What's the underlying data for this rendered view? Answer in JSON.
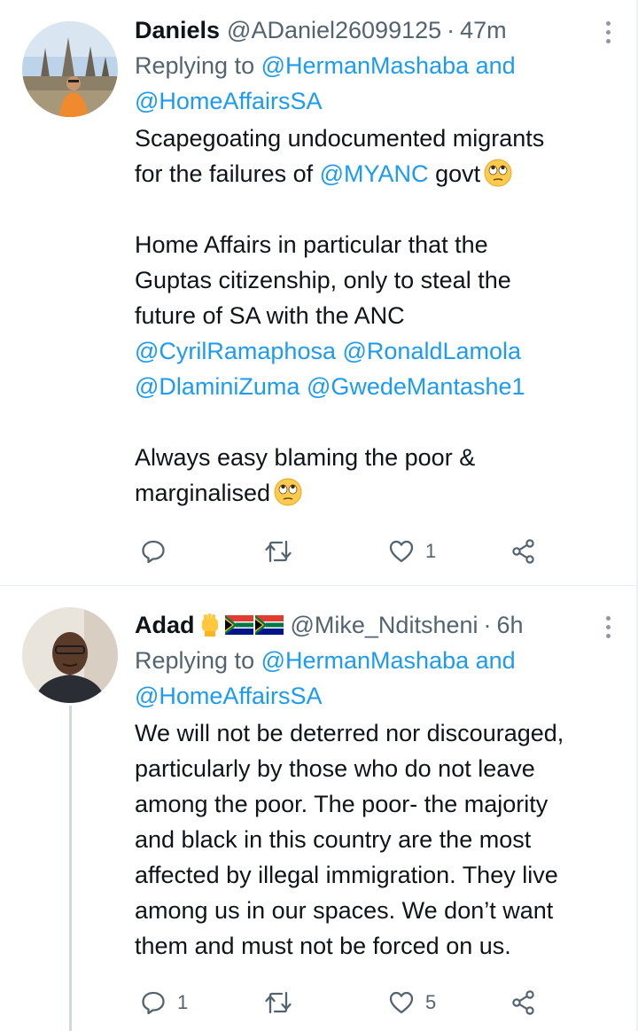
{
  "tweets": [
    {
      "name": "Daniels",
      "name_emoji": "",
      "handle": "@ADaniel26099125",
      "separator": "·",
      "time": "47m",
      "replying_prefix": "Replying to",
      "replying_to_1": "@HermanMashaba",
      "replying_and": "and",
      "replying_to_2": "@HomeAffairsSA",
      "body": {
        "line1": "Scapegoating undocumented migrants",
        "line2_a": "for the failures of",
        "line2_mention": "@MYANC",
        "line2_b": "govt",
        "para2_line1": "Home Affairs in particular that the",
        "para2_line2": "Guptas citizenship, only to steal the",
        "para2_line3": "future of SA with the ANC",
        "mention_a": "@CyrilRamaphosa",
        "mention_b": "@RonaldLamola",
        "mention_c": "@DlaminiZuma",
        "mention_d": "@GwedeMantashe1",
        "para3_line1": "Always easy blaming the poor &",
        "para3_line2": "marginalised"
      },
      "emoji_name": "face-with-rolling-eyes",
      "actions": {
        "reply_count": "",
        "retweet_count": "",
        "like_count": "1"
      }
    },
    {
      "name": "Adad",
      "name_emoji": "raised-fist-south-africa-flags",
      "handle": "@Mike_Nditsheni",
      "separator": "·",
      "time": "6h",
      "replying_prefix": "Replying to",
      "replying_to_1": "@HermanMashaba",
      "replying_and": "and",
      "replying_to_2": "@HomeAffairsSA",
      "body": {
        "line1": "We will not be deterred nor discouraged,",
        "line2": "particularly by those who do not leave",
        "line3": "among the poor. The poor- the majority",
        "line4": "and black in this country are the most",
        "line5": "affected by illegal immigration. They live",
        "line6": "among us in our spaces. We don’t want",
        "line7": "them and must not be forced on us."
      },
      "actions": {
        "reply_count": "1",
        "retweet_count": "",
        "like_count": "5"
      }
    }
  ],
  "colors": {
    "link": "#1d9bf0",
    "secondary_text": "#536471",
    "primary_text": "#0f1419",
    "divider": "#e6ecf0"
  }
}
